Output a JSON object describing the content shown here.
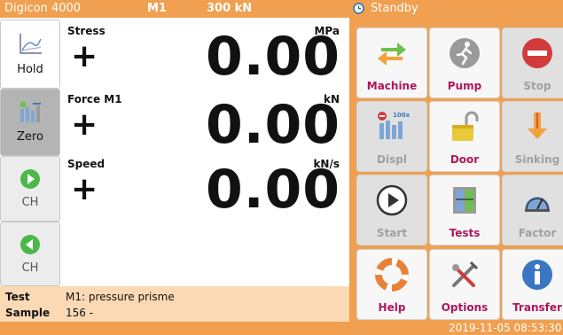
{
  "topbar": {
    "app_name": "Digicon 4000",
    "machine": "M1",
    "force": "300 kN",
    "state": "Standby"
  },
  "sidebar": {
    "hold_label": "Hold",
    "zero_label": "Zero",
    "ch1_label": "CH",
    "ch2_label": "CH"
  },
  "readouts": {
    "stress": {
      "name": "Stress",
      "unit": "MPa",
      "sign": "+",
      "value": "0.00"
    },
    "force": {
      "name": "Force M1",
      "unit": "kN",
      "sign": "+",
      "value": "0.00"
    },
    "speed": {
      "name": "Speed",
      "unit": "kN/s",
      "sign": "+",
      "value": "0.00"
    }
  },
  "info": {
    "test_label": "Test",
    "test_value": "M1: pressure prisme",
    "sample_label": "Sample",
    "sample_value": "156 -"
  },
  "tiles": {
    "machine": "Machine",
    "pump": "Pump",
    "stop": "Stop",
    "displ": "Displ",
    "door": "Door",
    "sinking": "Sinking",
    "start": "Start",
    "tests": "Tests",
    "factor": "Factor",
    "help": "Help",
    "options": "Options",
    "transfer": "Transfer",
    "displ_badge": "100x"
  },
  "status": {
    "datetime": "2019-11-05 08:53:30"
  },
  "colors": {
    "accent_orange": "#f0a050",
    "info_bg": "#fbd9b4",
    "tile_label_active": "#b0165a",
    "tile_label_disabled": "#a0a0a0"
  }
}
